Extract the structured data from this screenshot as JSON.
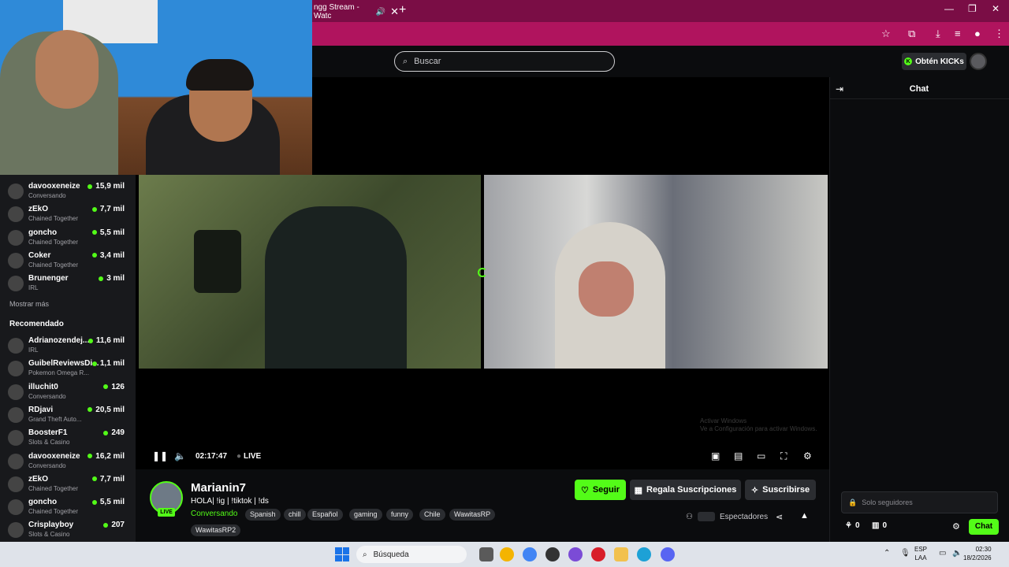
{
  "browser": {
    "tab_title": "ngg Stream - Watc",
    "tab_close": "✕",
    "new_tab": "+",
    "window_controls": {
      "minimize": "—",
      "maximize": "❐",
      "close": "✕"
    }
  },
  "header": {
    "search_placeholder": "Buscar",
    "get_kicks_label": "Obtén KICKs"
  },
  "sidebar": {
    "following": [
      {
        "name": "davooxeneize",
        "category": "Conversando",
        "viewers": "15,9 mil"
      },
      {
        "name": "zEkO",
        "category": "Chained Together",
        "viewers": "7,7 mil"
      },
      {
        "name": "goncho",
        "category": "Chained Together",
        "viewers": "5,5 mil"
      },
      {
        "name": "Coker",
        "category": "Chained Together",
        "viewers": "3,4 mil"
      },
      {
        "name": "Brunenger",
        "category": "IRL",
        "viewers": "3 mil"
      }
    ],
    "show_more": "Mostrar más",
    "recommended_heading": "Recomendado",
    "recommended": [
      {
        "name": "Adrianozendej...",
        "category": "IRL",
        "viewers": "11,6 mil"
      },
      {
        "name": "GuibelReviewsDi...",
        "category": "Pokemon Omega R...",
        "viewers": "1,1 mil"
      },
      {
        "name": "illuchit0",
        "category": "Conversando",
        "viewers": "126"
      },
      {
        "name": "RDjavi",
        "category": "Grand Theft Auto...",
        "viewers": "20,5 mil"
      },
      {
        "name": "BoosterF1",
        "category": "Slots & Casino",
        "viewers": "249"
      },
      {
        "name": "davooxeneize",
        "category": "Conversando",
        "viewers": "16,2 mil"
      },
      {
        "name": "zEkO",
        "category": "Chained Together",
        "viewers": "7,7 mil"
      },
      {
        "name": "goncho",
        "category": "Chained Together",
        "viewers": "5,5 mil"
      },
      {
        "name": "Crisplayboy",
        "category": "Slots & Casino",
        "viewers": "207"
      }
    ]
  },
  "player": {
    "time": "02:17:47",
    "live_label": "LIVE",
    "watermark_line1": "Activar Windows",
    "watermark_line2": "Ve a Configuración para activar Windows."
  },
  "stream": {
    "streamer": "Marianin7",
    "title": "HOLA| !ig | !tiktok | !ds",
    "category": "Conversando",
    "live_badge": "LIVE",
    "tags": [
      "Spanish",
      "chill",
      "Español",
      "gaming",
      "funny",
      "Chile",
      "WawitasRP",
      "WawitasRP2"
    ],
    "follow_label": "Seguir",
    "gift_label": "Regala Suscripciones",
    "subscribe_label": "Suscribirse",
    "viewers_label": "Espectadores"
  },
  "chat": {
    "title": "Chat",
    "input_placeholder": "Solo seguidores",
    "points": "0",
    "gifts": "0",
    "send_label": "Chat"
  },
  "taskbar": {
    "search_label": "Búsqueda",
    "lang_line1": "ESP",
    "lang_line2": "LAA",
    "time": "02:30",
    "date": "18/2/2026"
  },
  "colors": {
    "accent": "#53fc18",
    "tabbar": "#7a0d45",
    "toolbar": "#b0145e",
    "background": "#0b0c0e"
  }
}
